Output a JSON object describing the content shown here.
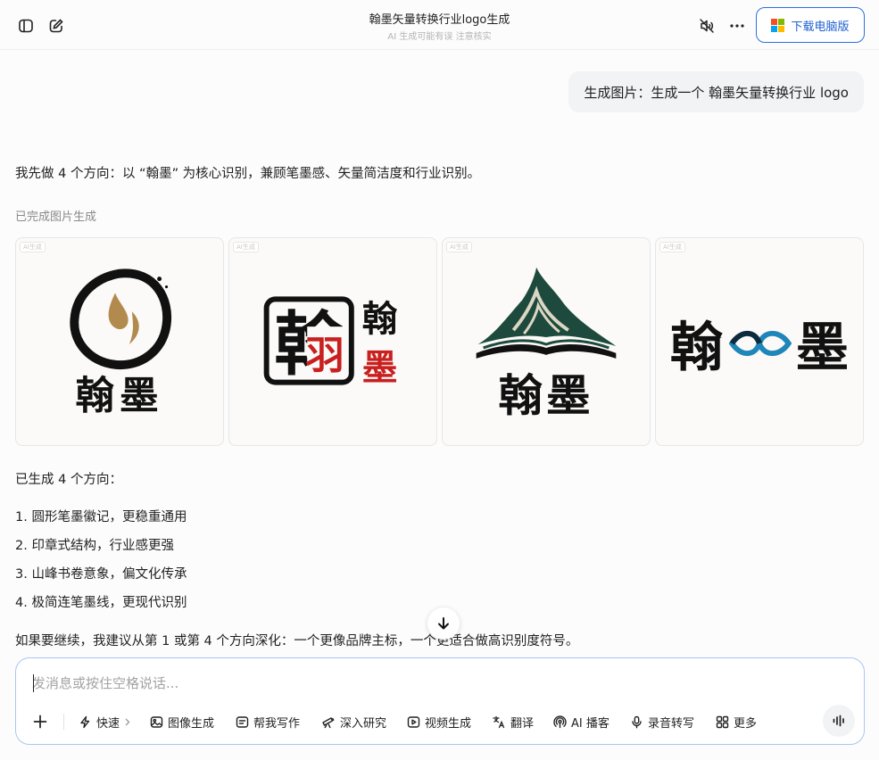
{
  "header": {
    "title": "翰墨矢量转换行业logo生成",
    "subtitle": "AI 生成可能有误 注意核实",
    "download_label": "下载电脑版",
    "icons": [
      "sidebar-toggle-icon",
      "new-chat-icon",
      "mute-icon",
      "more-icon",
      "microsoft-icon"
    ]
  },
  "conversation": {
    "user_message": "生成图片：生成一个 翰墨矢量转换行业 logo",
    "intro": "我先做 4 个方向：以 “翰墨” 为核心识别，兼顾笔墨感、矢量简洁度和行业识别。",
    "status": "已完成图片生成",
    "images": [
      {
        "tag": "AI生成",
        "name_text": "翰墨"
      },
      {
        "tag": "AI生成",
        "char_left": "翰",
        "char_right_top": "翰",
        "char_right_bottom": "墨"
      },
      {
        "tag": "AI生成",
        "name_text": "翰墨"
      },
      {
        "tag": "AI生成",
        "char_left": "翰",
        "char_right": "墨"
      }
    ],
    "summary_title": "已生成 4 个方向：",
    "list": [
      "1. 圆形笔墨徽记，更稳重通用",
      "2. 印章式结构，行业感更强",
      "3. 山峰书卷意象，偏文化传承",
      "4. 极简连笔墨线，更现代识别"
    ],
    "closing": "如果要继续，我建议从第 1 或第 4 个方向深化：一个更像品牌主标，一个更适合做高识别度符号。"
  },
  "composer": {
    "placeholder": "发消息或按住空格说话...",
    "tools": [
      {
        "label": "快速",
        "icon": "lightning-icon"
      },
      {
        "label": "图像生成",
        "icon": "image-icon"
      },
      {
        "label": "帮我写作",
        "icon": "write-icon"
      },
      {
        "label": "深入研究",
        "icon": "telescope-icon"
      },
      {
        "label": "视频生成",
        "icon": "video-icon"
      },
      {
        "label": "翻译",
        "icon": "translate-icon"
      },
      {
        "label": "AI 播客",
        "icon": "podcast-icon"
      },
      {
        "label": "录音转写",
        "icon": "mic-icon"
      },
      {
        "label": "更多",
        "icon": "grid-icon"
      }
    ]
  },
  "colors": {
    "accent": "#2d6fe0",
    "seal_red": "#c8201f",
    "mountain_green": "#1d4a3c",
    "infinity_blue": "#1e86b8"
  }
}
